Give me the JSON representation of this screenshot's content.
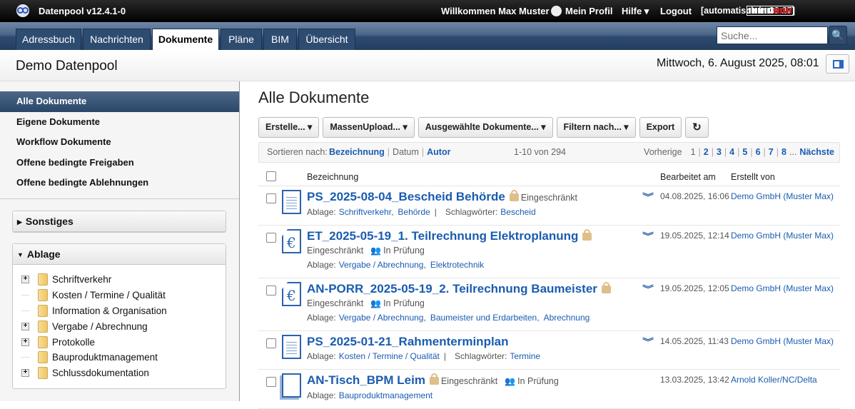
{
  "topbar": {
    "app_title": "Datenpool v12.4.1-0",
    "welcome": "Willkommen Max Muster",
    "profile": "Mein Profil",
    "help": "Hilfe ▾",
    "logout": "Logout",
    "auto_logout": "[automatisch in 33:27]",
    "session_remaining_fraction": 0.55
  },
  "nav": {
    "tabs": [
      "Adressbuch",
      "Nachrichten",
      "Dokumente",
      "Pläne",
      "BIM",
      "Übersicht"
    ],
    "active": "Dokumente",
    "search_placeholder": "Suche..."
  },
  "header": {
    "title": "Demo Datenpool",
    "date": "Mittwoch, 6. August 2025, 08:01"
  },
  "sidebar": {
    "items": [
      "Alle Dokumente",
      "Eigene Dokumente",
      "Workflow Dokumente",
      "Offene bedingte Freigaben",
      "Offene bedingte Ablehnungen"
    ],
    "panels": {
      "sonstiges": "Sonstiges",
      "ablage": "Ablage"
    },
    "tree": [
      {
        "label": "Schriftverkehr",
        "expandable": true
      },
      {
        "label": "Kosten / Termine / Qualität",
        "expandable": false
      },
      {
        "label": "Information & Organisation",
        "expandable": false
      },
      {
        "label": "Vergabe / Abrechnung",
        "expandable": true
      },
      {
        "label": "Protokolle",
        "expandable": true
      },
      {
        "label": "Bauproduktmanagement",
        "expandable": false
      },
      {
        "label": "Schlussdokumentation",
        "expandable": true
      }
    ]
  },
  "main": {
    "title": "Alle Dokumente",
    "toolbar": [
      "Erstelle... ▾",
      "MassenUpload... ▾",
      "Ausgewählte Dokumente... ▾",
      "Filtern nach... ▾",
      "Export"
    ],
    "sort": {
      "label": "Sortieren nach:",
      "options": [
        "Bezeichnung",
        "Datum",
        "Autor"
      ],
      "range": "1-10 von 294",
      "prev": "Vorherige",
      "pages": [
        "1",
        "2",
        "3",
        "4",
        "5",
        "6",
        "7",
        "8"
      ],
      "ellipsis": "...",
      "next": "Nächste"
    },
    "columns": {
      "name": "Bezeichnung",
      "edited": "Bearbeitet am",
      "created_by": "Erstellt von"
    },
    "ablage_label": "Ablage:",
    "tags_label": "Schlagwörter:",
    "rows": [
      {
        "icon": "lines",
        "title": "PS_2025-08-04_Bescheid Behörde",
        "restricted": "Eingeschränkt",
        "status": null,
        "ablage": [
          "Schriftverkehr,",
          "Behörde"
        ],
        "tags": "Bescheid",
        "date": "04.08.2025, 16:06",
        "by": "Demo GmbH (Muster Max)",
        "expand": true
      },
      {
        "icon": "euro",
        "title": "ET_2025-05-19_1. Teilrechnung Elektroplanung",
        "restricted": "Eingeschränkt",
        "status": "In Prüfung",
        "ablage": [
          "Vergabe / Abrechnung,",
          "Elektrotechnik"
        ],
        "tags": null,
        "date": "19.05.2025, 12:14",
        "by": "Demo GmbH (Muster Max)",
        "expand": true
      },
      {
        "icon": "euro",
        "title": "AN-PORR_2025-05-19_2. Teilrechnung Baumeister",
        "restricted": "Eingeschränkt",
        "status": "In Prüfung",
        "ablage": [
          "Vergabe / Abrechnung,",
          "Baumeister und Erdarbeiten,",
          "Abrechnung"
        ],
        "tags": null,
        "date": "19.05.2025, 12:05",
        "by": "Demo GmbH (Muster Max)",
        "expand": true
      },
      {
        "icon": "lines",
        "title": "PS_2025-01-21_Rahmenterminplan",
        "restricted": null,
        "status": null,
        "ablage": [
          "Kosten / Termine / Qualität"
        ],
        "tags": "Termine",
        "date": "14.05.2025, 11:43",
        "by": "Demo GmbH (Muster Max)",
        "expand": true
      },
      {
        "icon": "stack",
        "title": "AN-Tisch_BPM Leim",
        "restricted": "Eingeschränkt",
        "status": "In Prüfung",
        "ablage": [
          "Bauproduktmanagement"
        ],
        "tags": null,
        "date": "13.03.2025, 13:42",
        "by": "Arnold Koller/NC/Delta",
        "expand": false
      }
    ]
  }
}
